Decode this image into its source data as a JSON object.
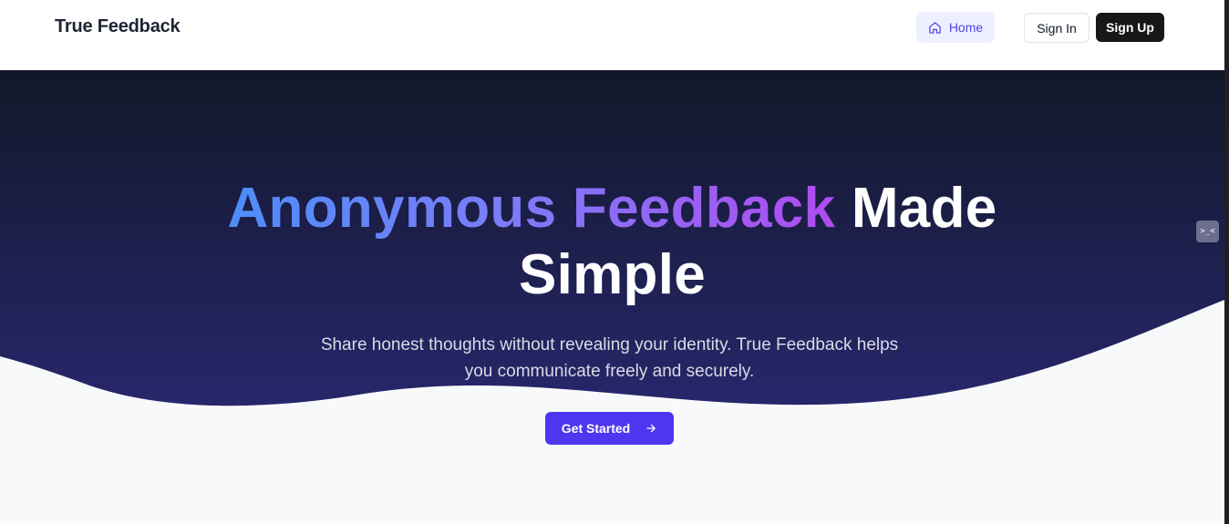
{
  "header": {
    "brand": "True Feedback",
    "nav": {
      "home_label": "Home",
      "home_icon": "home-icon"
    },
    "sign_in_label": "Sign In",
    "sign_up_label": "Sign Up"
  },
  "hero": {
    "headline_gradient": "Anonymous Feedback",
    "headline_rest": "Made Simple",
    "subtitle": "Share honest thoughts without revealing your identity. True Feedback helps you communicate freely and securely.",
    "cta_label": "Get Started",
    "cta_icon": "arrow-right-icon"
  },
  "side_widget": {
    "icon": "terminal-face-icon",
    "glyph": ">_<"
  },
  "colors": {
    "hero_top": "#121829",
    "hero_bottom": "#27266b",
    "accent": "#4f35f0",
    "gradient_start": "#4d8dfb",
    "gradient_end": "#b04cf0",
    "page_bg": "#f8f9fb"
  }
}
